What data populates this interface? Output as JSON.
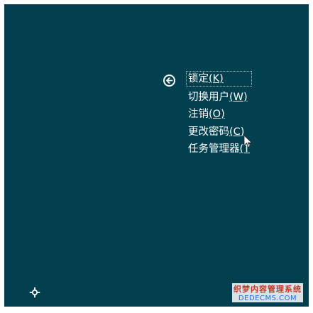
{
  "menu": {
    "items": [
      {
        "label": "锁定",
        "hotkey": "(K)"
      },
      {
        "label": "切换用户",
        "hotkey": "(W)"
      },
      {
        "label": "注销",
        "hotkey": "(O)"
      },
      {
        "label": "更改密码",
        "hotkey": "(C)"
      },
      {
        "label": "任务管理器",
        "hotkey": "(T"
      }
    ]
  },
  "icons": {
    "back": "back-arrow-icon",
    "ease_of_access": "ease-of-access-icon"
  },
  "watermark": {
    "line1": "织梦内容管理系统",
    "line2": "DEDECMS.COM"
  },
  "colors": {
    "background": "#03404f",
    "text": "#ffffff"
  }
}
